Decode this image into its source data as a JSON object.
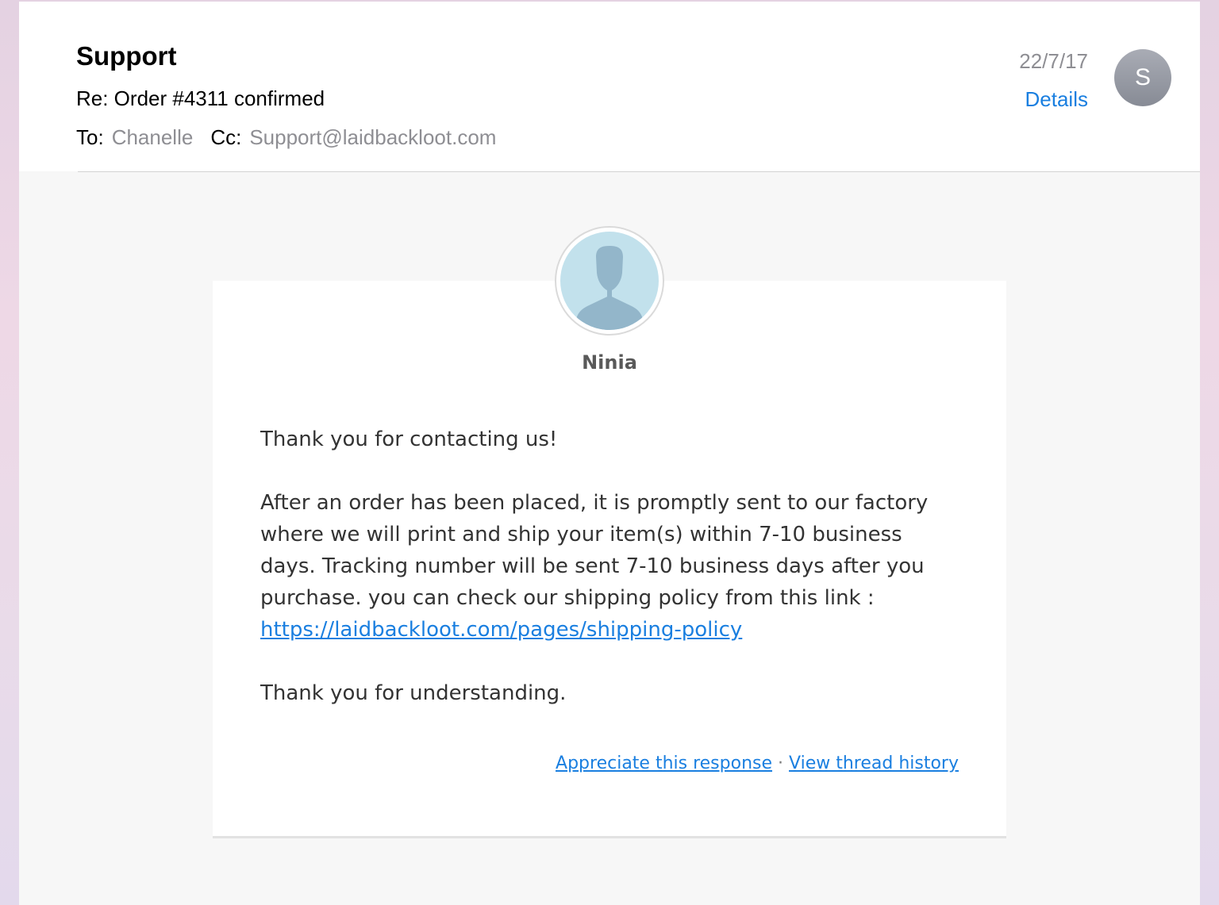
{
  "header": {
    "sender": "Support",
    "subject": "Re: Order #4311 confirmed",
    "to_label": "To:",
    "to_value": "Chanelle",
    "cc_label": "Cc:",
    "cc_value": "Support@laidbackloot.com",
    "date": "22/7/17",
    "details_label": "Details",
    "avatar_initial": "S"
  },
  "card": {
    "agent_name": "Ninia",
    "avatar_icon": "person-silhouette-icon",
    "greeting": "Thank you for contacting us!",
    "body": "After an order has been placed, it is promptly sent to our factory where we will print and ship your item(s) within 7-10 business days. Tracking number will be sent 7-10 business days after you purchase. you can check our shipping policy from this link :",
    "link": "https://laidbackloot.com/pages/shipping-policy",
    "closing": "Thank you for understanding.",
    "appreciate_label": "Appreciate this response",
    "separator": "·",
    "history_label": "View thread history"
  },
  "colors": {
    "link": "#1a7fe0",
    "secondary_text": "#8e8e93",
    "avatar_bg": "#c2e1ec",
    "silhouette": "#93b6ca"
  }
}
